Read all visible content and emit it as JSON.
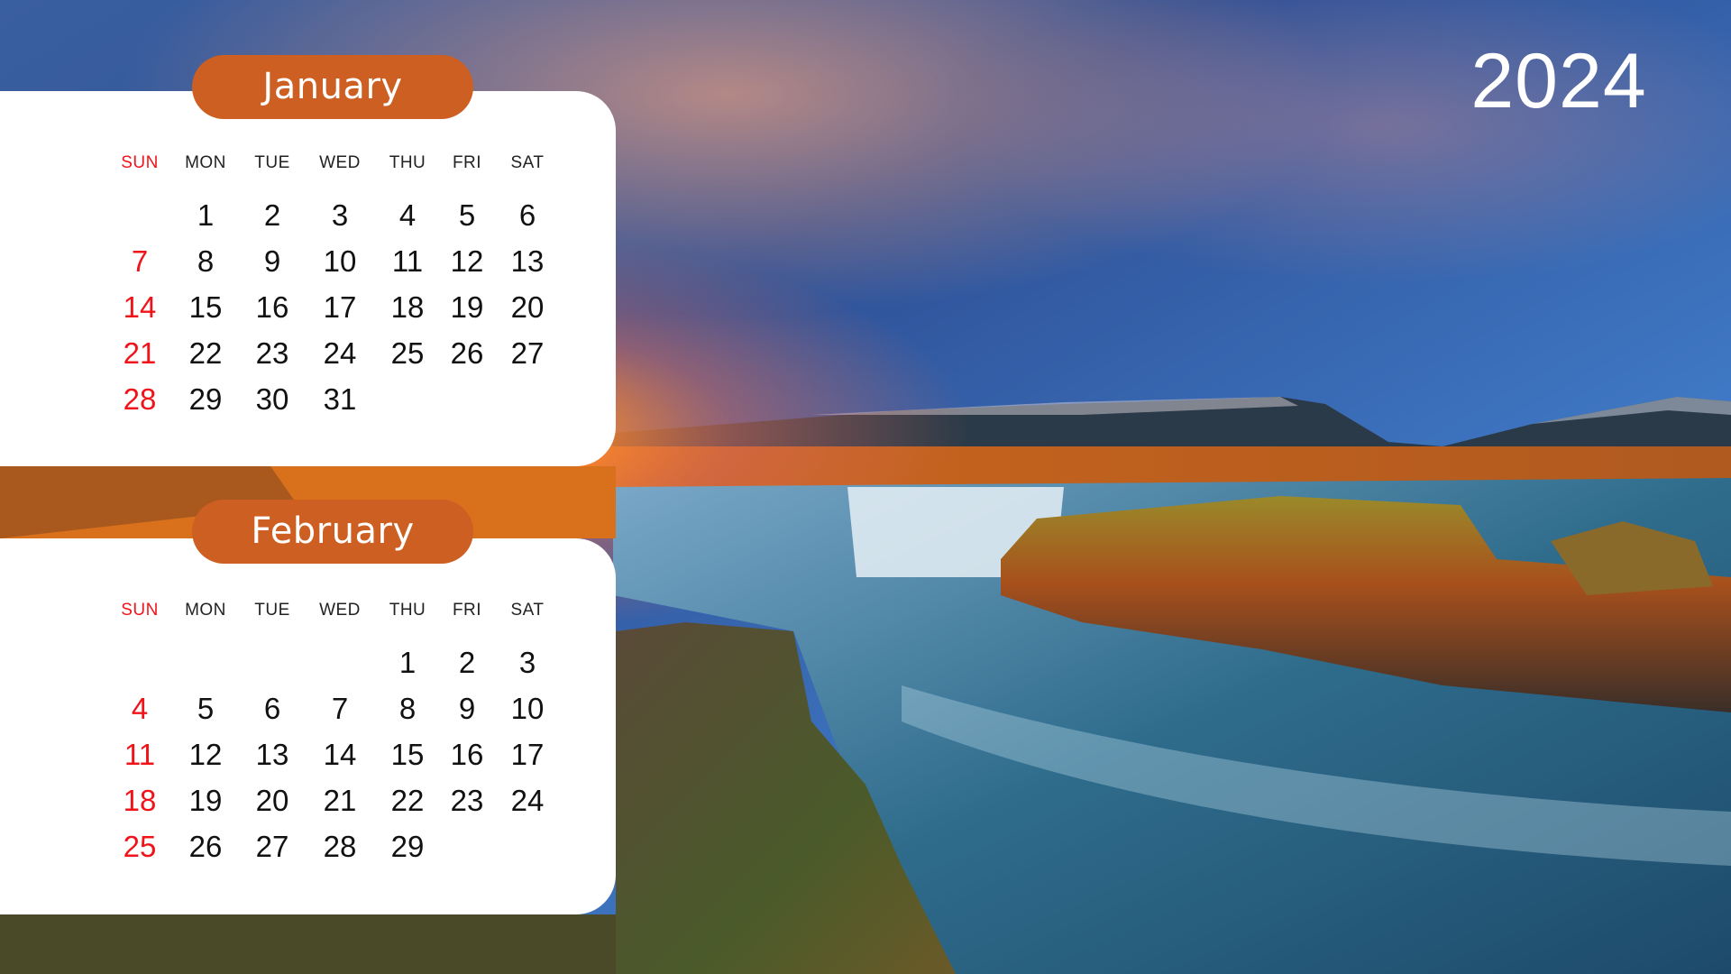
{
  "year": "2024",
  "colors": {
    "accent": "#CD5F22",
    "sunday": "#F0141A",
    "text": "#111111",
    "card": "#FFFFFF"
  },
  "weekday_headers": [
    "SUN",
    "MON",
    "TUE",
    "WED",
    "THU",
    "FRI",
    "SAT"
  ],
  "months": [
    {
      "name": "January",
      "weeks": [
        [
          "",
          "1",
          "2",
          "3",
          "4",
          "5",
          "6"
        ],
        [
          "7",
          "8",
          "9",
          "10",
          "11",
          "12",
          "13"
        ],
        [
          "14",
          "15",
          "16",
          "17",
          "18",
          "19",
          "20"
        ],
        [
          "21",
          "22",
          "23",
          "24",
          "25",
          "26",
          "27"
        ],
        [
          "28",
          "29",
          "30",
          "31",
          "",
          "",
          ""
        ]
      ]
    },
    {
      "name": "February",
      "weeks": [
        [
          "",
          "",
          "",
          "",
          "1",
          "2",
          "3"
        ],
        [
          "4",
          "5",
          "6",
          "7",
          "8",
          "9",
          "10"
        ],
        [
          "11",
          "12",
          "13",
          "14",
          "15",
          "16",
          "17"
        ],
        [
          "18",
          "19",
          "20",
          "21",
          "22",
          "23",
          "24"
        ],
        [
          "25",
          "26",
          "27",
          "28",
          "29",
          "",
          ""
        ]
      ]
    }
  ],
  "background": {
    "scene": "sunset-waterfall-landscape"
  }
}
